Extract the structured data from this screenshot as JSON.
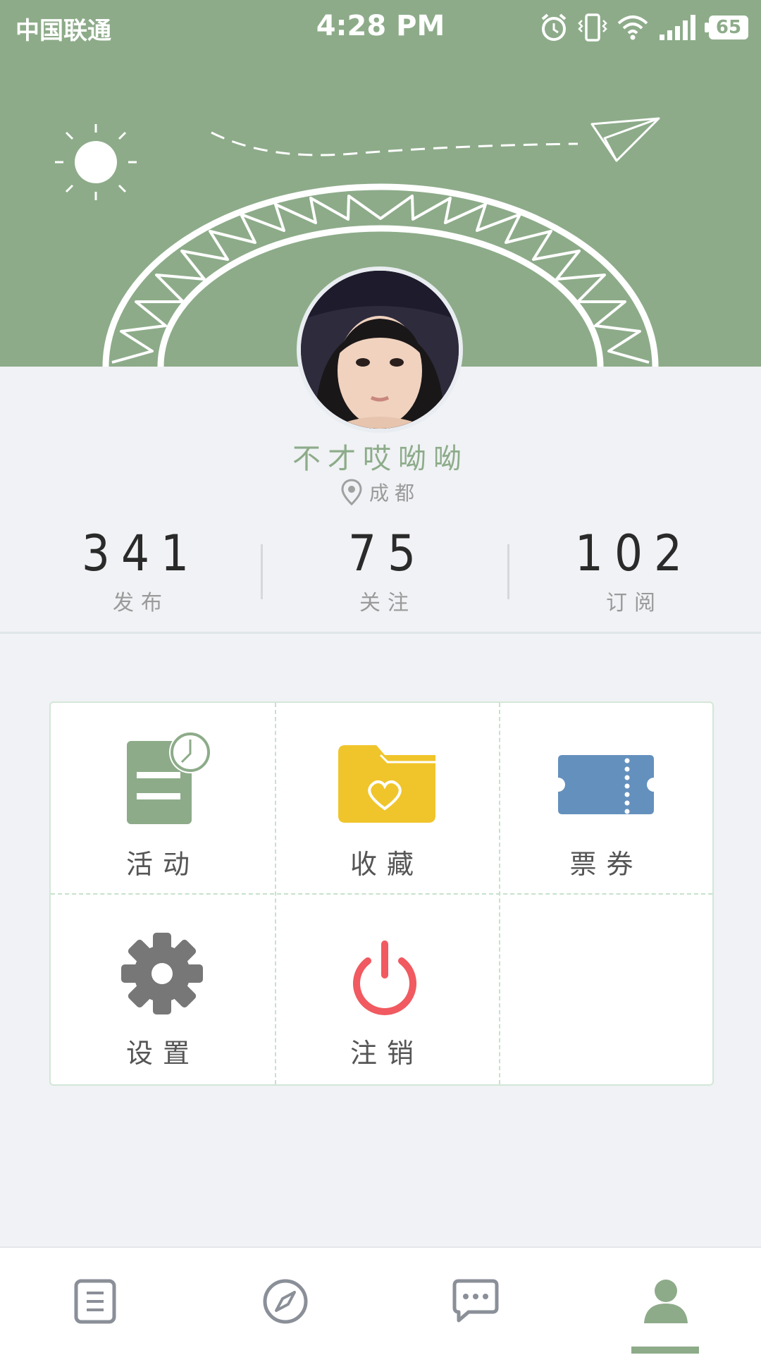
{
  "status_bar": {
    "carrier": "中国联通",
    "time": "4:28 PM",
    "battery": "65"
  },
  "profile": {
    "name": "不才哎呦呦",
    "location": "成都"
  },
  "stats": [
    {
      "value": "341",
      "label": "发布"
    },
    {
      "value": "75",
      "label": "关注"
    },
    {
      "value": "102",
      "label": "订阅"
    }
  ],
  "menu": [
    {
      "label": "活动",
      "icon": "activity-icon"
    },
    {
      "label": "收藏",
      "icon": "favorites-folder-icon"
    },
    {
      "label": "票券",
      "icon": "ticket-icon"
    },
    {
      "label": "设置",
      "icon": "gear-icon"
    },
    {
      "label": "注销",
      "icon": "power-icon"
    }
  ],
  "bottom_nav": [
    {
      "icon": "document-list-icon"
    },
    {
      "icon": "compass-icon"
    },
    {
      "icon": "message-icon"
    },
    {
      "icon": "profile-icon",
      "active": true
    }
  ],
  "colors": {
    "accent": "#8dab89",
    "background": "#f0f2f5",
    "folder": "#f0c52b",
    "ticket": "#6490bd",
    "logout": "#f05a60",
    "gear": "#777777"
  }
}
